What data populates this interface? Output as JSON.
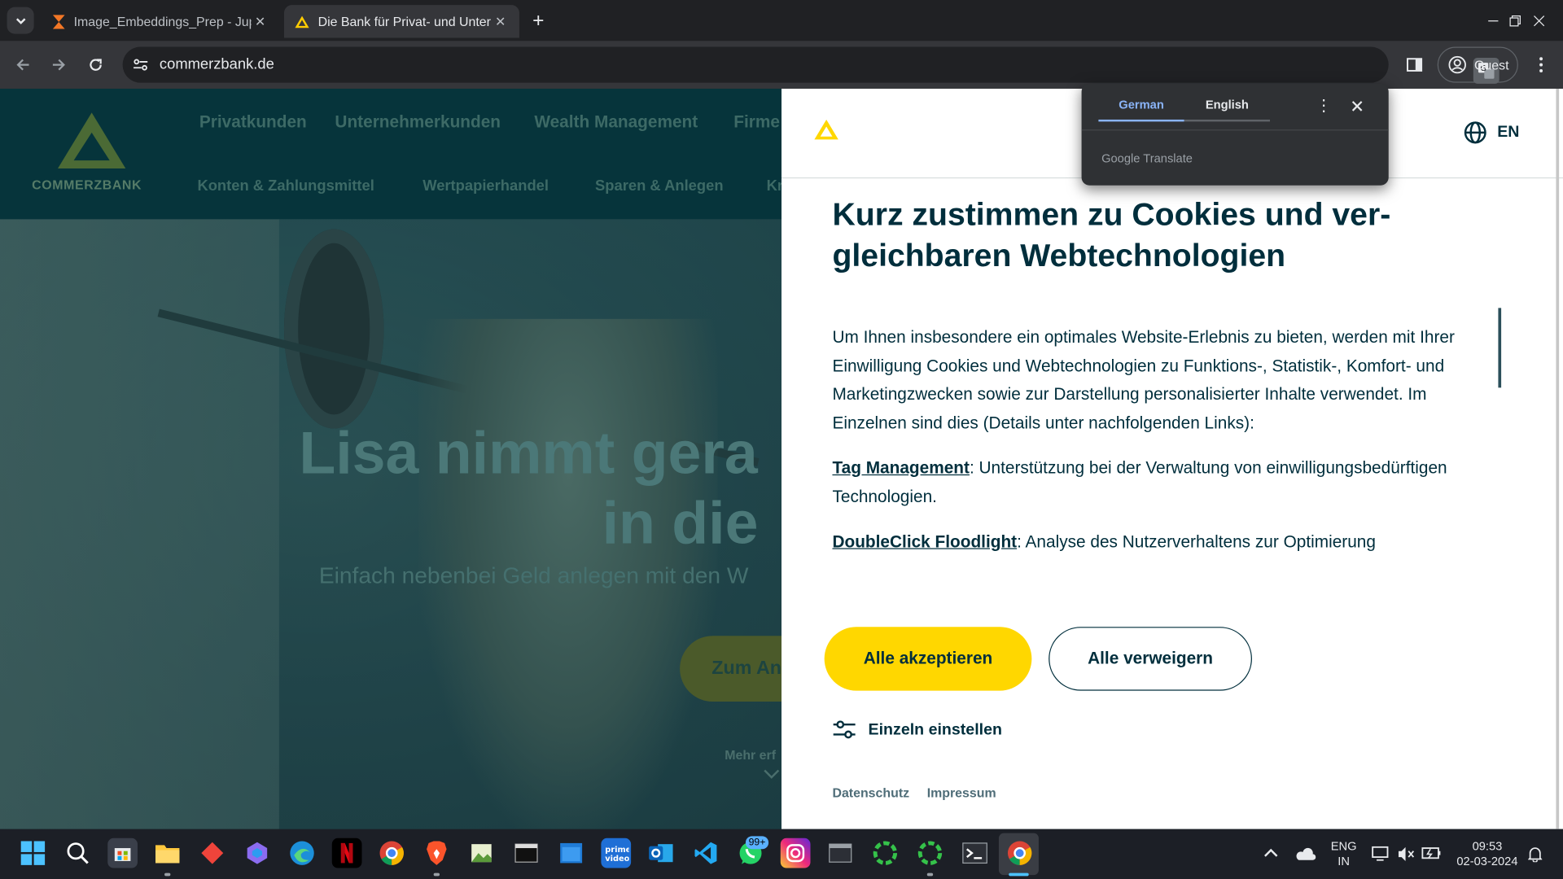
{
  "browser": {
    "tabs": [
      {
        "title": "Image_Embeddings_Prep - Jupyter",
        "active": false
      },
      {
        "title": "Die Bank für Privat- und Unternehmerkunden",
        "active": true
      }
    ],
    "url": "commerzbank.de",
    "profile_label": "Guest"
  },
  "site": {
    "brand": "COMMERZBANK",
    "nav_primary": [
      "Privatkunden",
      "Unternehmerkunden",
      "Wealth Management",
      "Firme"
    ],
    "nav_secondary": [
      "Konten & Zahlungsmittel",
      "Wertpapierhandel",
      "Sparen & Anlegen",
      "Kr"
    ],
    "hero": {
      "title_line1": "Lisa nimmt gera",
      "title_line2": "in die",
      "subtitle": "Einfach nebenbei Geld anlegen mit den W",
      "cta": "Zum An",
      "more": "Mehr erf"
    }
  },
  "cookie_dialog": {
    "language_label": "EN",
    "title": "Kurz zustimmen zu Cookies und ver­gleichbaren Webtechnologien",
    "intro": "Um Ihnen insbesondere ein optimales Website-Erlebnis zu bieten, werden mit Ihrer Einwilligung Cookies und Webtechnologien zu Funktions-, Statis­tik-, Komfort- und Marketingzwecken sowie zur Darstellung personalisier­ter Inhalte verwendet. Im Einzelnen sind dies (Details unter nachfolgenden Links):",
    "items": [
      {
        "link": "Tag Management",
        "text": ": Unterstützung bei der Verwaltung von einwilligungsbe­dürftigen Technologien."
      },
      {
        "link": "DoubleClick Floodlight",
        "text": ": Analyse des Nutzerverhaltens zur Optimierung"
      }
    ],
    "accept_label": "Alle akzeptieren",
    "decline_label": "Alle verweigern",
    "settings_label": "Einzeln einstellen",
    "footer_links": [
      "Datenschutz",
      "Impressum"
    ]
  },
  "translate_popup": {
    "tabs": [
      "German",
      "English"
    ],
    "selected": "German",
    "brand": "Google Translate"
  },
  "taskbar": {
    "badge": "99+",
    "lang_line1": "ENG",
    "lang_line2": "IN",
    "time": "09:53",
    "date": "02-03-2024"
  },
  "colors": {
    "brand_yellow": "#ffd700",
    "dark_petrol": "#002e3c",
    "chrome_bg": "#202124",
    "chrome_toolbar": "#35363a",
    "translate_accent": "#8ab4f8"
  }
}
